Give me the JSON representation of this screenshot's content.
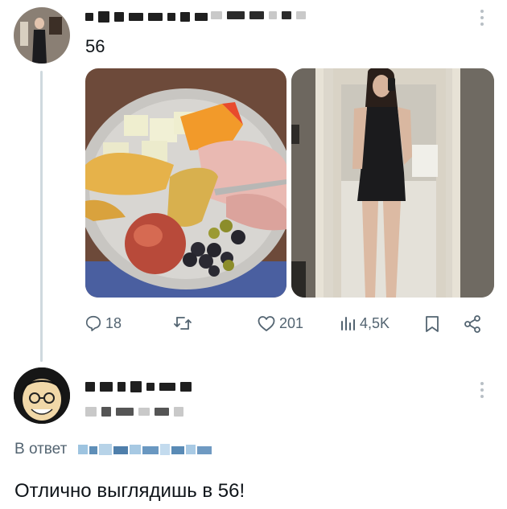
{
  "tweet": {
    "text": "56",
    "stats": {
      "replies": "18",
      "likes": "201",
      "views": "4,5K"
    }
  },
  "reply": {
    "in_reply_prefix": "В ответ",
    "text": "Отлично выглядишь в 56!"
  },
  "icons": {
    "reply": "comment-bubble-icon",
    "retweet": "retweet-icon",
    "like": "heart-icon",
    "views": "bar-chart-icon",
    "bookmark": "bookmark-icon",
    "share": "share-icon",
    "more": "more-vertical-icon"
  },
  "colors": {
    "text": "#0f1419",
    "muted": "#536471",
    "thread_line": "#cfd9de",
    "blurred_name_tint": "#7fb3d9"
  }
}
